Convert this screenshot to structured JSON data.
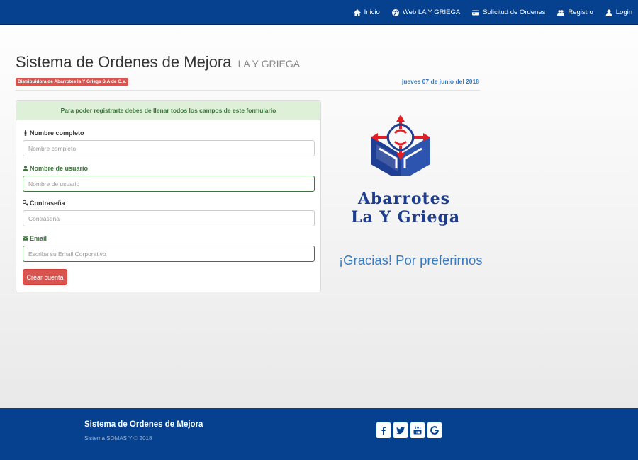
{
  "nav": {
    "items": [
      {
        "label": "Inicio",
        "icon": "home-icon"
      },
      {
        "label": "Web LA Y GRIEGA",
        "icon": "globe-icon"
      },
      {
        "label": "Solicitud de Ordenes",
        "icon": "card-icon"
      },
      {
        "label": "Registro",
        "icon": "users-icon"
      },
      {
        "label": "Login",
        "icon": "user-icon"
      }
    ]
  },
  "header": {
    "title": "Sistema de Ordenes de Mejora",
    "subtitle": "LA Y GRIEGA",
    "company_badge": "Distribuidora de Abarrotes la Y Griega S.A de C.V.",
    "date": "jueves 07 de junio del 2018"
  },
  "form": {
    "heading": "Para poder registrarte debes de llenar todos los campos de este formulario",
    "fields": {
      "fullname": {
        "label": "Nombre completo",
        "placeholder": "Nombre completo",
        "value": ""
      },
      "username": {
        "label": "Nombre de usuario",
        "placeholder": "Nombre de usuario",
        "value": ""
      },
      "password": {
        "label": "Contraseña",
        "placeholder": "Contraseña",
        "value": ""
      },
      "email": {
        "label": "Email",
        "placeholder": "Escriba su Email Corporativo",
        "value": ""
      }
    },
    "submit_label": "Crear cuenta"
  },
  "logo": {
    "line1": "Abarrotes",
    "line2": "La Y Griega"
  },
  "thanks": "¡Gracias! Por preferirnos",
  "footer": {
    "title": "Sistema de Ordenes de Mejora",
    "subtitle": "Sistema SOMAS Y © 2018",
    "social": [
      "facebook-icon",
      "twitter-icon",
      "youtube-icon",
      "google-icon"
    ]
  },
  "colors": {
    "brand_blue": "#05418f",
    "danger": "#d9534f",
    "success": "#3c763d",
    "link_blue": "#3a7bbf"
  }
}
